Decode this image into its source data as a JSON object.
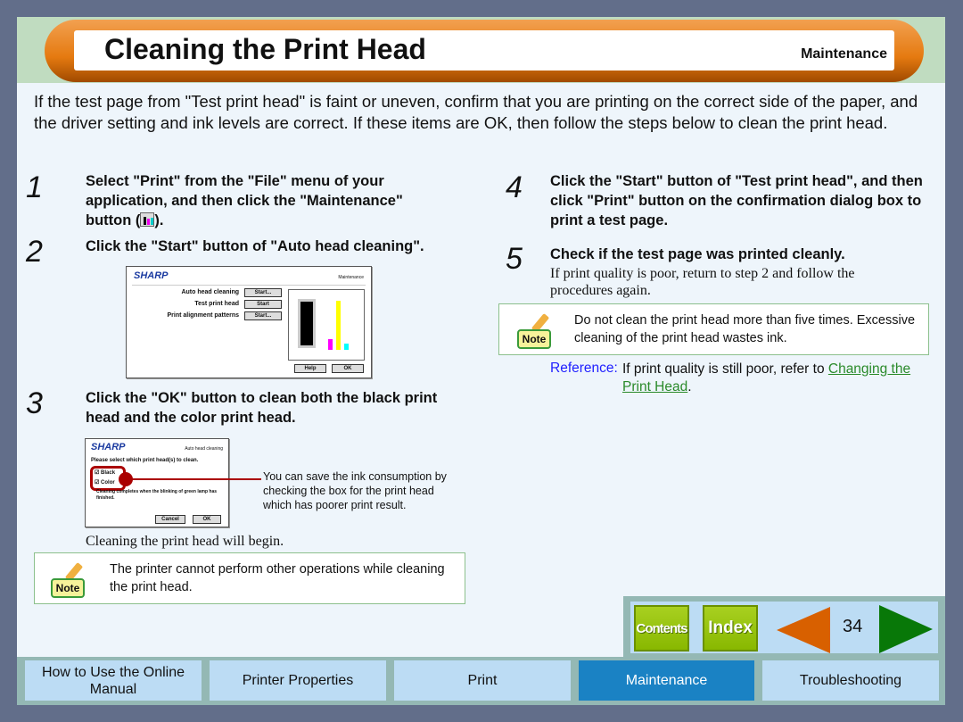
{
  "header": {
    "title": "Cleaning the Print Head",
    "section": "Maintenance"
  },
  "intro": "If the test page from \"Test print head\" is faint or uneven, confirm that you are printing on the correct side of the paper, and the driver setting and ink levels are correct. If these items are OK, then follow the steps below to clean the print head.",
  "steps": [
    {
      "num": "1",
      "text": "Select \"Print\" from the \"File\" menu of your application, and then click the \"Maintenance\" button (",
      "text_end": ")."
    },
    {
      "num": "2",
      "text": "Click the \"Start\" button of \"Auto head cleaning\"."
    },
    {
      "num": "3",
      "text": "Click the \"OK\" button to clean both the black print head and the color print head."
    },
    {
      "num": "4",
      "text": "Click the \"Start\" button of \"Test print head\", and then click \"Print\" button on the confirmation dialog box to print a test page."
    },
    {
      "num": "5",
      "text": "Check if the test page was printed cleanly.",
      "detail": "If print quality is poor, return to step 2 and follow the procedures again."
    }
  ],
  "dialog1": {
    "logo": "SHARP",
    "tab": "Maintenance",
    "rows": [
      {
        "label": "Auto head cleaning",
        "button": "Start..."
      },
      {
        "label": "Test print head",
        "button": "Start"
      },
      {
        "label": "Print alignment patterns",
        "button": "Start..."
      }
    ],
    "help": "Help",
    "ok": "OK",
    "ink_colors": [
      "#000000",
      "#ff00ff",
      "#ffff00",
      "#00ffff"
    ]
  },
  "dialog2": {
    "logo": "SHARP",
    "tab": "Auto head cleaning",
    "prompt": "Please select which print head(s) to clean.",
    "options": [
      {
        "label": "Black",
        "checked": true
      },
      {
        "label": "Color",
        "checked": true
      }
    ],
    "info": "Cleaning completes when the blinking of green lamp has finished.",
    "cancel": "Cancel",
    "ok": "OK"
  },
  "callout": "You can save the ink consumption by checking the box for the print head which has poorer print result.",
  "step3_after": "Cleaning the print head will begin.",
  "note_left": {
    "badge": "Note",
    "text": "The printer cannot perform other operations while cleaning the print head."
  },
  "note_right": {
    "badge": "Note",
    "text": "Do not clean the print head more than five times. Excessive cleaning of the print head wastes ink."
  },
  "reference": {
    "label": "Reference:",
    "text": "If print quality is still poor, refer to ",
    "link": "Changing the Print Head",
    "end": "."
  },
  "nav": {
    "contents": "Contents",
    "index": "Index",
    "page": "34"
  },
  "footer_tabs": [
    {
      "label": "How to Use the Online Manual"
    },
    {
      "label": "Printer Properties"
    },
    {
      "label": "Print"
    },
    {
      "label": "Maintenance",
      "active": true
    },
    {
      "label": "Troubleshooting"
    }
  ],
  "colors": {
    "accent": "#1a82c4",
    "header_orange": "#e57a10",
    "link": "#2a8a2a",
    "reference": "#2020ff"
  }
}
